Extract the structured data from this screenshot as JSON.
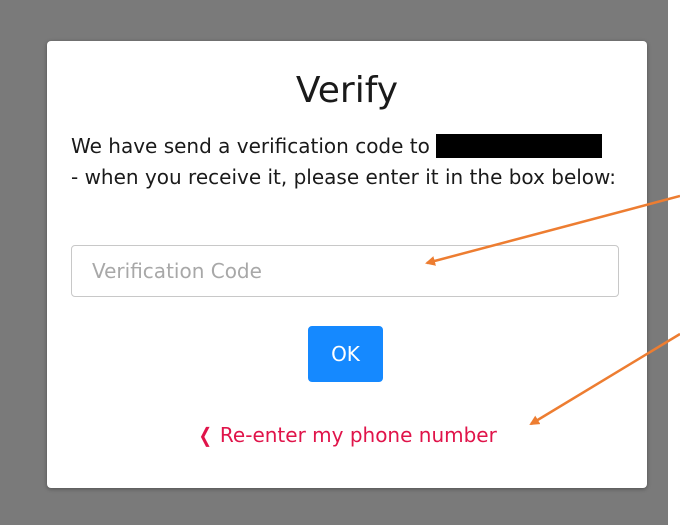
{
  "dialog": {
    "title": "Verify",
    "message_line_1": "We have send a verification code to",
    "message_line_2": "- when you receive it, please enter it in the box below:",
    "input": {
      "placeholder": "Verification Code",
      "value": ""
    },
    "ok_label": "OK",
    "reenter_label": "Re-enter my phone number",
    "reenter_icon": "chevron-left-icon"
  },
  "colors": {
    "backdrop": "#7a7a7a",
    "ok_button": "#1589ff",
    "link": "#e0144a",
    "annotation_arrow": "#ed7d31",
    "redaction": "#000000"
  }
}
